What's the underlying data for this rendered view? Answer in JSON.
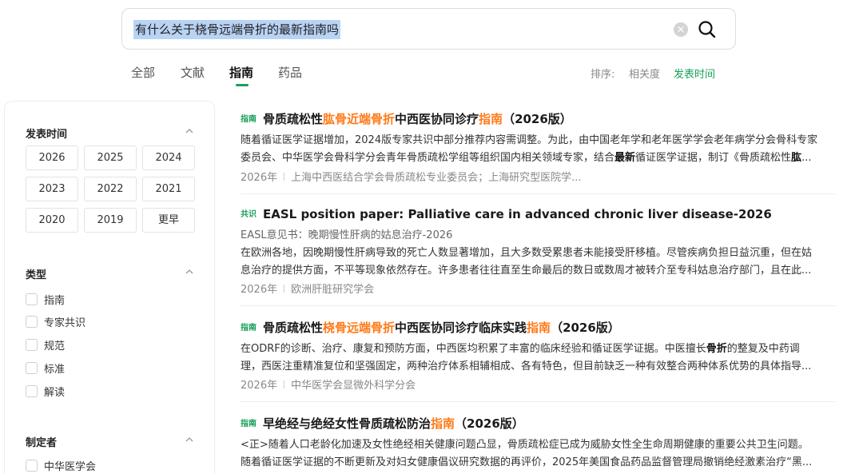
{
  "search": {
    "query": "有什么关于桡骨远端骨折的最新指南吗"
  },
  "tabs": [
    {
      "label": "全部"
    },
    {
      "label": "文献"
    },
    {
      "label": "指南"
    },
    {
      "label": "药品"
    }
  ],
  "sort": {
    "label": "排序:",
    "options": [
      "相关度",
      "发表时间"
    ],
    "active": "发表时间"
  },
  "colors": {
    "accent": "#18a058",
    "highlight": "#ff7a1a",
    "query_selection": "#b9d3f5"
  },
  "sidebar": {
    "publish_time": {
      "title": "发表时间",
      "years": [
        "2026",
        "2025",
        "2024",
        "2023",
        "2022",
        "2021",
        "2020",
        "2019",
        "更早"
      ]
    },
    "type": {
      "title": "类型",
      "options": [
        "指南",
        "专家共识",
        "规范",
        "标准",
        "解读"
      ]
    },
    "maker": {
      "title": "制定者",
      "options": [
        "中华医学会"
      ]
    }
  },
  "results": [
    {
      "badge": "指南",
      "title_parts": [
        "骨质疏松性",
        "肱骨近端骨折",
        "中西医协同诊疗",
        "指南",
        "（2026版）"
      ],
      "abstract_line1": "随着循证医学证据增加，2024版专家共识中部分推荐内容需调整。为此，由中国老年学和老年医学学会老年病学分会骨科专家",
      "abstract_line2_parts": [
        "委员会、中华医学会骨科学分会青年骨质疏松学组等组织国内相关领域专家，结合",
        "最新",
        "循证医学证据，制订《骨质疏松性",
        "肱",
        "..."
      ],
      "year": "2026年",
      "org": "上海中西医结合学会骨质疏松专业委员会；上海研究型医院学..."
    },
    {
      "badge": "共识",
      "title": "EASL position paper: Palliative care in advanced chronic liver disease-2026",
      "subtitle": "EASL意见书：晚期慢性肝病的姑息治疗-2026",
      "abstract_line1": "在欧洲各地，因晚期慢性肝病导致的死亡人数显著增加，且大多数受累患者未能接受肝移植。尽管疾病负担日益沉重，但在姑",
      "abstract_line2": "息治疗的提供方面，不平等现象依然存在。许多患者往往直至生命最后的数日或数周才被转介至专科姑息治疗部门，且在此...",
      "year": "2026年",
      "org": "欧洲肝脏研究学会"
    },
    {
      "badge": "指南",
      "title_parts": [
        "骨质疏松性",
        "桡骨远端骨折",
        "中西医协同诊疗临床实践",
        "指南",
        "（2026版）"
      ],
      "abstract_line1_parts": [
        "在ODRF的诊断、治疗、康复和预防方面，中西医均积累了丰富的临床经验和循证医学证据。中医擅长",
        "骨折",
        "的整复及中药调"
      ],
      "abstract_line2": "理，西医注重精准复位和坚强固定，两种治疗体系相辅相成、各有特色，但目前缺乏一种有效整合两种体系优势的具体指导...",
      "year": "2026年",
      "org": "中华医学会显微外科学分会"
    },
    {
      "badge": "指南",
      "title_parts": [
        "早绝经与绝经女性骨质疏松防治",
        "指南",
        "（2026版）"
      ],
      "abstract_line1": "<正>随着人口老龄化加速及女性绝经相关健康问题凸显，骨质疏松症已成为威胁女性全生命周期健康的重要公共卫生问题。",
      "abstract_line2": "随着循证医学证据的不断更新及对妇女健康倡议研究数据的再评价，2025年美国食品药品监督管理局撤销绝经激素治疗“黑..."
    }
  ]
}
